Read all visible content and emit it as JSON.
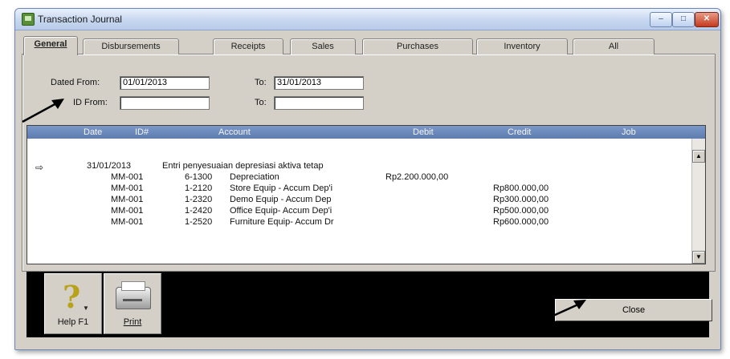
{
  "window": {
    "title": "Transaction Journal",
    "controls": {
      "minimize": "–",
      "maximize": "□",
      "close": "✕"
    }
  },
  "tabs": [
    {
      "label": "General",
      "active": true
    },
    {
      "label": "Disbursements"
    },
    {
      "label": "Receipts"
    },
    {
      "label": "Sales"
    },
    {
      "label": "Purchases"
    },
    {
      "label": "Inventory"
    },
    {
      "label": "All"
    }
  ],
  "filters": {
    "dated_from_label": "Dated From:",
    "dated_from_value": "01/01/2013",
    "dated_to_label": "To:",
    "dated_to_value": "31/01/2013",
    "id_from_label": "ID From:",
    "id_from_value": "",
    "id_to_label": "To:",
    "id_to_value": ""
  },
  "grid": {
    "columns": [
      "Date",
      "ID#",
      "Account",
      "Debit",
      "Credit",
      "Job"
    ],
    "entry": {
      "date": "31/01/2013",
      "memo": "Entri penyesuaian depresiasi aktiva tetap",
      "lines": [
        {
          "id": "MM-001",
          "account_no": "6-1300",
          "account_name": "Depreciation",
          "debit": "Rp2.200.000,00",
          "credit": ""
        },
        {
          "id": "MM-001",
          "account_no": "1-2120",
          "account_name": "Store Equip - Accum Dep'i",
          "debit": "",
          "credit": "Rp800.000,00"
        },
        {
          "id": "MM-001",
          "account_no": "1-2320",
          "account_name": "Demo Equip - Accum Dep",
          "debit": "",
          "credit": "Rp300.000,00"
        },
        {
          "id": "MM-001",
          "account_no": "1-2420",
          "account_name": "Office Equip- Accum Dep'i",
          "debit": "",
          "credit": "Rp500.000,00"
        },
        {
          "id": "MM-001",
          "account_no": "1-2520",
          "account_name": "Furniture Equip- Accum Dr",
          "debit": "",
          "credit": "Rp600.000,00"
        }
      ]
    },
    "selector_glyph": "⇨",
    "scroll_up": "▲",
    "scroll_down": "▼"
  },
  "toolbar": {
    "help_label": "Help F1",
    "help_glyph": "?",
    "help_drop": "▼",
    "print_label": "Print",
    "close_label": "Close"
  },
  "colors": {
    "window_face": "#d4d0c8",
    "grid_header": "#6a87bb",
    "annotation_arrow": "#000000"
  }
}
